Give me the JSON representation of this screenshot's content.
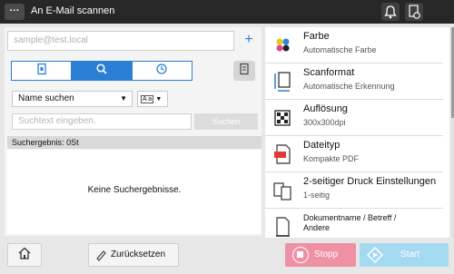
{
  "header": {
    "menu_label": "···",
    "title": "An E-Mail scannen"
  },
  "destination": {
    "placeholder": "sample@test.local",
    "add_label": "+"
  },
  "tabs": [
    {
      "icon": "address-book-icon"
    },
    {
      "icon": "search-icon"
    },
    {
      "icon": "history-clock-icon"
    }
  ],
  "search": {
    "mode_value": "Name suchen",
    "text_placeholder": "Suchtext eingeben.",
    "search_label": "Suchen",
    "aa_label": "A a",
    "results_label": "Suchergebnis:",
    "results_count": "0St",
    "empty_message": "Keine Suchergebnisse."
  },
  "settings": [
    {
      "label": "Farbe",
      "value": "Automatische Farbe",
      "icon": "color-icon"
    },
    {
      "label": "Scanformat",
      "value": "Automatische Erkennung",
      "icon": "scan-size-icon"
    },
    {
      "label": "Auflösung",
      "value": "300x300dpi",
      "icon": "resolution-icon"
    },
    {
      "label": "Dateityp",
      "value": "Kompakte PDF",
      "icon": "pdf-file-icon"
    },
    {
      "label": "2-seitiger Druck Einstellungen",
      "value": "1-seitig",
      "icon": "duplex-icon"
    },
    {
      "label": "Dokumentname / Betreff /",
      "value": "Andere",
      "icon": "document-name-icon"
    }
  ],
  "footer": {
    "reset_label": "Zurücksetzen",
    "stop_label": "Stopp",
    "start_label": "Start"
  },
  "colors": {
    "accent": "#2a7fd4",
    "stop": "#ef90a5",
    "start": "#a4d9f2",
    "topbar": "#272727"
  }
}
